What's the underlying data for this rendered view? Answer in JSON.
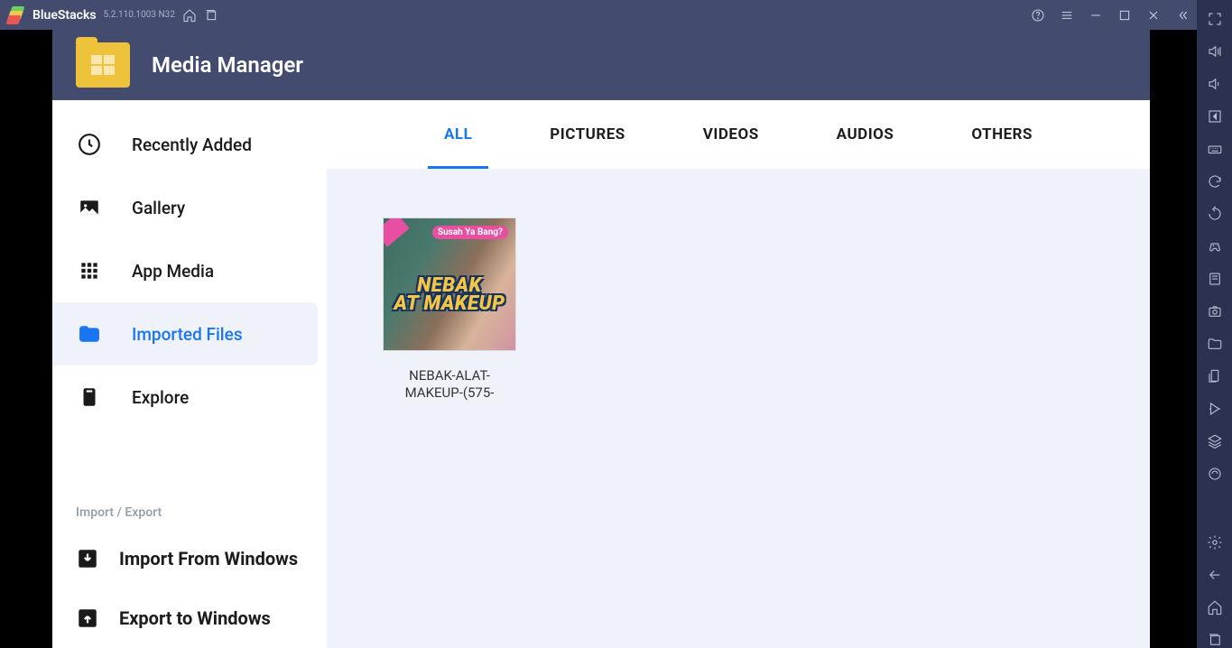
{
  "titlebar": {
    "app_name": "BlueStacks",
    "version": "5.2.110.1003 N32"
  },
  "header": {
    "title": "Media Manager"
  },
  "sidebar": {
    "items": [
      {
        "label": "Recently Added"
      },
      {
        "label": "Gallery"
      },
      {
        "label": "App Media"
      },
      {
        "label": "Imported Files"
      },
      {
        "label": "Explore"
      }
    ],
    "section_label": "Import / Export",
    "actions": [
      {
        "label": "Import From Windows"
      },
      {
        "label": "Export to Windows"
      }
    ]
  },
  "tabs": [
    {
      "label": "ALL",
      "active": true
    },
    {
      "label": "PICTURES"
    },
    {
      "label": "VIDEOS"
    },
    {
      "label": "AUDIOS"
    },
    {
      "label": "OTHERS"
    }
  ],
  "files": [
    {
      "name": "NEBAK-ALAT-MAKEUP-(575-",
      "thumb_overlay_line1": "NEBAK",
      "thumb_overlay_line2": "AT MAKEUP",
      "thumb_badge": "Susah Ya Bang?"
    }
  ]
}
